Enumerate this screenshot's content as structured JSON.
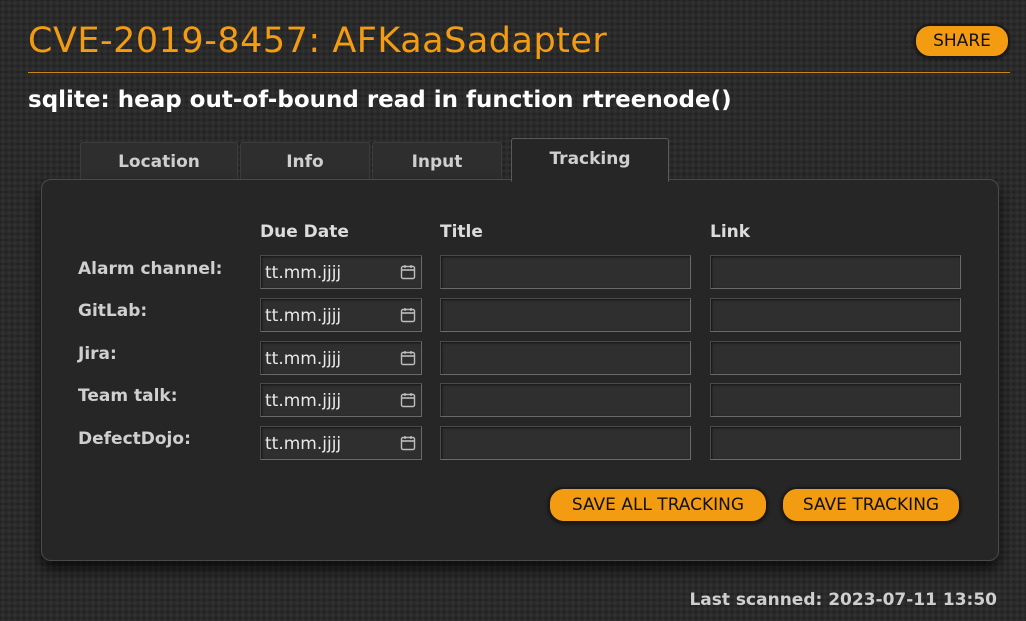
{
  "header": {
    "title": "CVE-2019-8457: AFKaaSadapter",
    "share_label": "SHARE",
    "accent_color": "#f39c12"
  },
  "subtitle": "sqlite: heap out-of-bound read in function rtreenode()",
  "tabs": [
    {
      "label": "Location",
      "active": false
    },
    {
      "label": "Info",
      "active": false
    },
    {
      "label": "Input",
      "active": false
    },
    {
      "label": "Tracking",
      "active": true
    }
  ],
  "tracking": {
    "columns": {
      "due_date": "Due Date",
      "title": "Title",
      "link": "Link"
    },
    "rows": [
      {
        "label": "Alarm channel:",
        "date_placeholder": "tt.mm.jjjj",
        "title": "",
        "link": ""
      },
      {
        "label": "GitLab:",
        "date_placeholder": "tt.mm.jjjj",
        "title": "",
        "link": ""
      },
      {
        "label": "Jira:",
        "date_placeholder": "tt.mm.jjjj",
        "title": "",
        "link": ""
      },
      {
        "label": "Team talk:",
        "date_placeholder": "tt.mm.jjjj",
        "title": "",
        "link": ""
      },
      {
        "label": "DefectDojo:",
        "date_placeholder": "tt.mm.jjjj",
        "title": "",
        "link": ""
      }
    ],
    "save_all_label": "SAVE ALL TRACKING",
    "save_label": "SAVE TRACKING"
  },
  "footer": {
    "last_scanned": "Last scanned: 2023-07-11 13:50"
  },
  "icons": {
    "date_picker": "calendar-icon"
  }
}
